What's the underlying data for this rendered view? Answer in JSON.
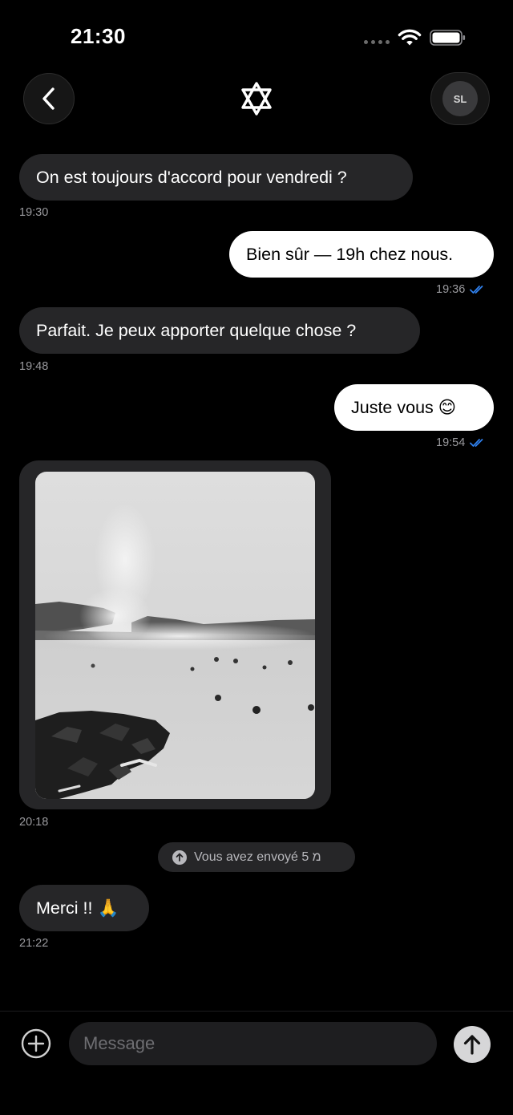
{
  "status_bar": {
    "time": "21:30"
  },
  "header": {
    "back_icon": "chevron-left-icon",
    "center_icon": "star-of-david-icon",
    "avatar_initials": "SL"
  },
  "messages": [
    {
      "direction": "in",
      "text": "On est toujours d'accord pour vendredi ?",
      "time": "19:30"
    },
    {
      "direction": "out",
      "text": "Bien sûr — 19h chez nous.",
      "time": "19:36",
      "status": "read"
    },
    {
      "direction": "in",
      "text": "Parfait. Je peux apporter quelque chose ?",
      "time": "19:48"
    },
    {
      "direction": "out",
      "text": "Juste vous 😊",
      "time": "19:54",
      "status": "read"
    },
    {
      "direction": "in",
      "type": "image",
      "time": "20:18"
    },
    {
      "direction": "in",
      "text": "Merci !! 🙏",
      "time": "21:22"
    }
  ],
  "system_notice": {
    "text": "Vous avez envoyé 5 מ",
    "icon": "arrow-up-circle-icon"
  },
  "composer": {
    "placeholder": "Message",
    "add_icon": "plus-circle-icon",
    "send_icon": "arrow-up-icon"
  },
  "colors": {
    "background": "#000000",
    "incoming_bubble": "#262628",
    "outgoing_bubble": "#ffffff",
    "read_ticks": "#2f80ed"
  }
}
